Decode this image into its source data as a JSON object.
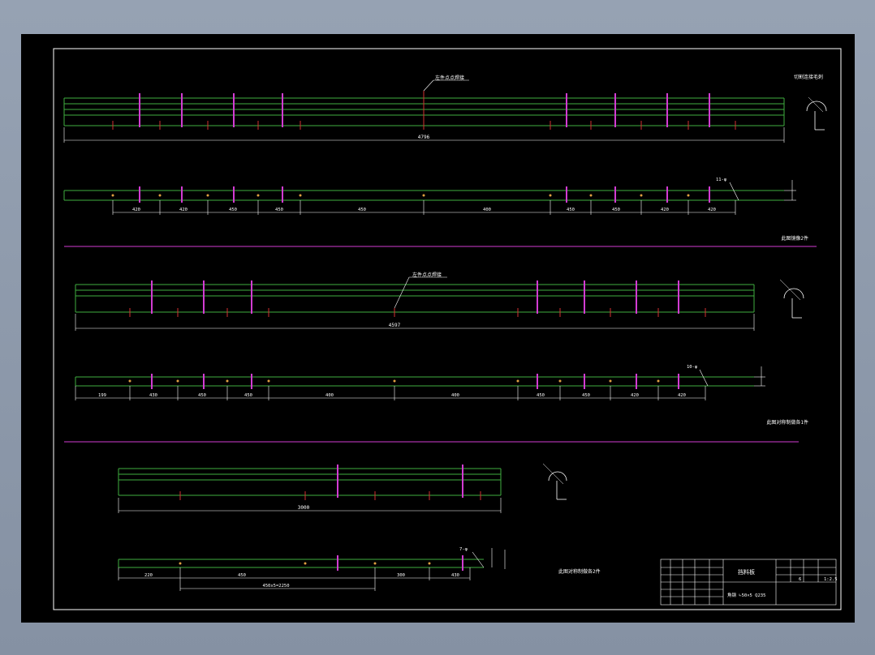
{
  "drawing": {
    "sections": [
      {
        "id": "a",
        "total_length": "4796",
        "weld_note": "左件点点焊接",
        "spacing": [
          "420",
          "420",
          "450",
          "450",
          "450",
          "400",
          "450",
          "450",
          "420",
          "420"
        ],
        "edge_note": "11-φ",
        "note": "此图镜像2件"
      },
      {
        "id": "b",
        "total_length": "4597",
        "weld_note": "左件点点焊接",
        "spacing": [
          "199",
          "430",
          "450",
          "450",
          "400",
          "400",
          "450",
          "450",
          "420",
          "420"
        ],
        "edge_note": "10-φ",
        "note": "此图对称制做各1件"
      },
      {
        "id": "c",
        "total_length": "3000",
        "spacing": [
          "220",
          "450",
          "300",
          "430"
        ],
        "cumulative": "450x5=2250",
        "edge_note": "7-φ",
        "note": "此图对称制做各2件"
      }
    ],
    "top_right_note": "切割连接毛刺",
    "title_block": {
      "part_name": "挡料板",
      "material": "角钢 ∟50×5 Q235",
      "scale": "1:2.5",
      "quantity": "6"
    }
  }
}
